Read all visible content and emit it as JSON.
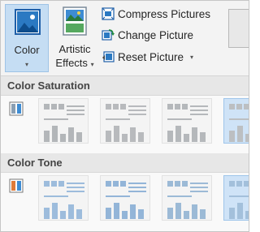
{
  "ribbon": {
    "color_label": "Color",
    "artistic_label_1": "Artistic",
    "artistic_label_2": "Effects",
    "compress_label": "Compress Pictures",
    "change_label": "Change Picture",
    "reset_label": "Reset Picture",
    "caret": "▾"
  },
  "gallery": {
    "sections": [
      {
        "title": "Color Saturation",
        "tint": "gray"
      },
      {
        "title": "Color Tone",
        "tint": "blue"
      }
    ]
  },
  "colors": {
    "accent": "#c5ddf3",
    "selected_thumb": "#cfe3f7"
  }
}
